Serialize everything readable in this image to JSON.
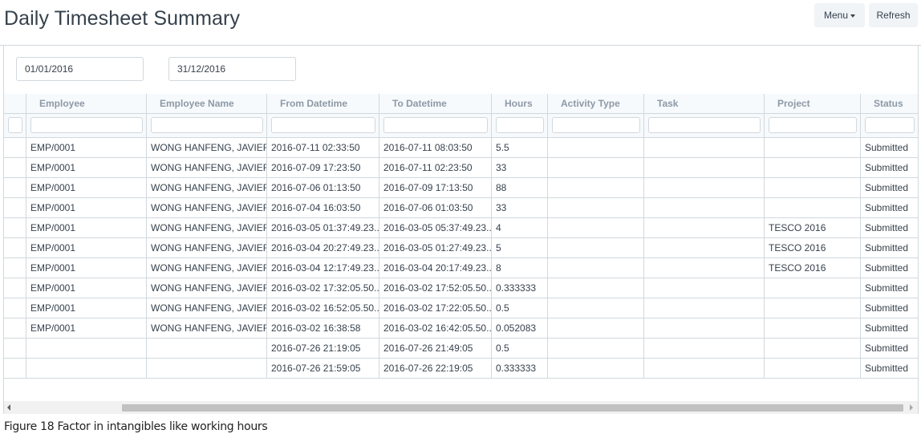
{
  "page": {
    "title": "Daily Timesheet Summary",
    "menu_label": "Menu",
    "refresh_label": "Refresh"
  },
  "filters": {
    "from_date": "01/01/2016",
    "to_date": "31/12/2016"
  },
  "table": {
    "columns": [
      {
        "key": "idx",
        "label": ""
      },
      {
        "key": "employee",
        "label": "Employee"
      },
      {
        "key": "employee_name",
        "label": "Employee Name"
      },
      {
        "key": "from_datetime",
        "label": "From Datetime"
      },
      {
        "key": "to_datetime",
        "label": "To Datetime"
      },
      {
        "key": "hours",
        "label": "Hours"
      },
      {
        "key": "activity_type",
        "label": "Activity Type"
      },
      {
        "key": "task",
        "label": "Task"
      },
      {
        "key": "project",
        "label": "Project"
      },
      {
        "key": "status",
        "label": "Status"
      }
    ],
    "rows": [
      {
        "idx": "",
        "employee": "EMP/0001",
        "employee_name": "WONG HANFENG, JAVIER",
        "from_datetime": "2016-07-11 02:33:50",
        "to_datetime": "2016-07-11 08:03:50",
        "hours": "5.5",
        "activity_type": "",
        "task": "",
        "project": "",
        "status": "Submitted"
      },
      {
        "idx": "",
        "employee": "EMP/0001",
        "employee_name": "WONG HANFENG, JAVIER",
        "from_datetime": "2016-07-09 17:23:50",
        "to_datetime": "2016-07-11 02:23:50",
        "hours": "33",
        "activity_type": "",
        "task": "",
        "project": "",
        "status": "Submitted"
      },
      {
        "idx": "",
        "employee": "EMP/0001",
        "employee_name": "WONG HANFENG, JAVIER",
        "from_datetime": "2016-07-06 01:13:50",
        "to_datetime": "2016-07-09 17:13:50",
        "hours": "88",
        "activity_type": "",
        "task": "",
        "project": "",
        "status": "Submitted"
      },
      {
        "idx": "",
        "employee": "EMP/0001",
        "employee_name": "WONG HANFENG, JAVIER",
        "from_datetime": "2016-07-04 16:03:50",
        "to_datetime": "2016-07-06 01:03:50",
        "hours": "33",
        "activity_type": "",
        "task": "",
        "project": "",
        "status": "Submitted"
      },
      {
        "idx": "",
        "employee": "EMP/0001",
        "employee_name": "WONG HANFENG, JAVIER",
        "from_datetime": "2016-03-05 01:37:49.23...",
        "to_datetime": "2016-03-05 05:37:49.23...",
        "hours": "4",
        "activity_type": "",
        "task": "",
        "project": "TESCO 2016",
        "status": "Submitted"
      },
      {
        "idx": "",
        "employee": "EMP/0001",
        "employee_name": "WONG HANFENG, JAVIER",
        "from_datetime": "2016-03-04 20:27:49.23...",
        "to_datetime": "2016-03-05 01:27:49.23...",
        "hours": "5",
        "activity_type": "",
        "task": "",
        "project": "TESCO 2016",
        "status": "Submitted"
      },
      {
        "idx": "",
        "employee": "EMP/0001",
        "employee_name": "WONG HANFENG, JAVIER",
        "from_datetime": "2016-03-04 12:17:49.23...",
        "to_datetime": "2016-03-04 20:17:49.23...",
        "hours": "8",
        "activity_type": "",
        "task": "",
        "project": "TESCO 2016",
        "status": "Submitted"
      },
      {
        "idx": "",
        "employee": "EMP/0001",
        "employee_name": "WONG HANFENG, JAVIER",
        "from_datetime": "2016-03-02 17:32:05.50...",
        "to_datetime": "2016-03-02 17:52:05.50...",
        "hours": "0.333333",
        "activity_type": "",
        "task": "",
        "project": "",
        "status": "Submitted"
      },
      {
        "idx": "",
        "employee": "EMP/0001",
        "employee_name": "WONG HANFENG, JAVIER",
        "from_datetime": "2016-03-02 16:52:05.50...",
        "to_datetime": "2016-03-02 17:22:05.50...",
        "hours": "0.5",
        "activity_type": "",
        "task": "",
        "project": "",
        "status": "Submitted"
      },
      {
        "idx": "",
        "employee": "EMP/0001",
        "employee_name": "WONG HANFENG, JAVIER",
        "from_datetime": "2016-03-02 16:38:58",
        "to_datetime": "2016-03-02 16:42:05.50...",
        "hours": "0.052083",
        "activity_type": "",
        "task": "",
        "project": "",
        "status": "Submitted"
      },
      {
        "idx": "",
        "employee": "",
        "employee_name": "",
        "from_datetime": "2016-07-26 21:19:05",
        "to_datetime": "2016-07-26 21:49:05",
        "hours": "0.5",
        "activity_type": "",
        "task": "",
        "project": "",
        "status": "Submitted"
      },
      {
        "idx": "",
        "employee": "",
        "employee_name": "",
        "from_datetime": "2016-07-26 21:59:05",
        "to_datetime": "2016-07-26 22:19:05",
        "hours": "0.333333",
        "activity_type": "",
        "task": "",
        "project": "",
        "status": "Submitted"
      }
    ]
  },
  "caption": "Figure 18 Factor in intangibles like working hours"
}
